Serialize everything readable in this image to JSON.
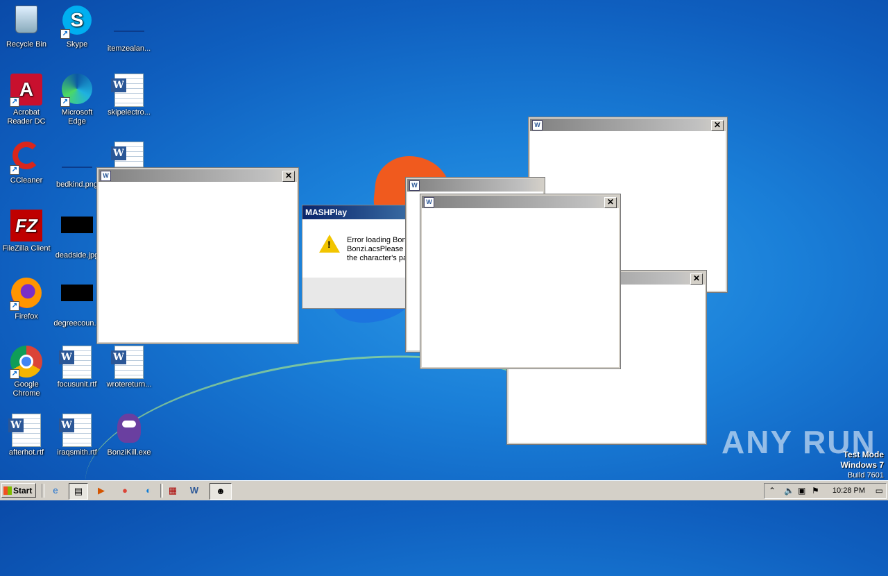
{
  "desktop": {
    "icons": [
      {
        "label": "Recycle Bin"
      },
      {
        "label": "Skype"
      },
      {
        "label": "itemzealan..."
      },
      {
        "label": "Acrobat Reader DC"
      },
      {
        "label": "Microsoft Edge"
      },
      {
        "label": "skipelectro..."
      },
      {
        "label": "CCleaner"
      },
      {
        "label": "bedkind.png"
      },
      {
        "label": "FileZilla Client"
      },
      {
        "label": "deadside.jpg"
      },
      {
        "label": "Firefox"
      },
      {
        "label": "degreecoun..."
      },
      {
        "label": "Google Chrome"
      },
      {
        "label": "focusunit.rtf"
      },
      {
        "label": "wrotereturn..."
      },
      {
        "label": "afterhot.rtf"
      },
      {
        "label": "iraqsmith.rtf"
      },
      {
        "label": "BonziKill.exe"
      }
    ]
  },
  "message_box": {
    "title": "MASHPlay",
    "text": "Error loading Bonz\nBonzi.acsPlease o\nthe character's pa"
  },
  "watermark": {
    "brand": "ANY RUN",
    "mode": "Test Mode",
    "os": "Windows 7",
    "build": "Build 7601"
  },
  "taskbar": {
    "start_label": "Start",
    "clock": "10:28 PM"
  },
  "icons": {
    "window_icon": "word-doc-icon",
    "close": "close-icon",
    "warning": "warning-icon"
  }
}
